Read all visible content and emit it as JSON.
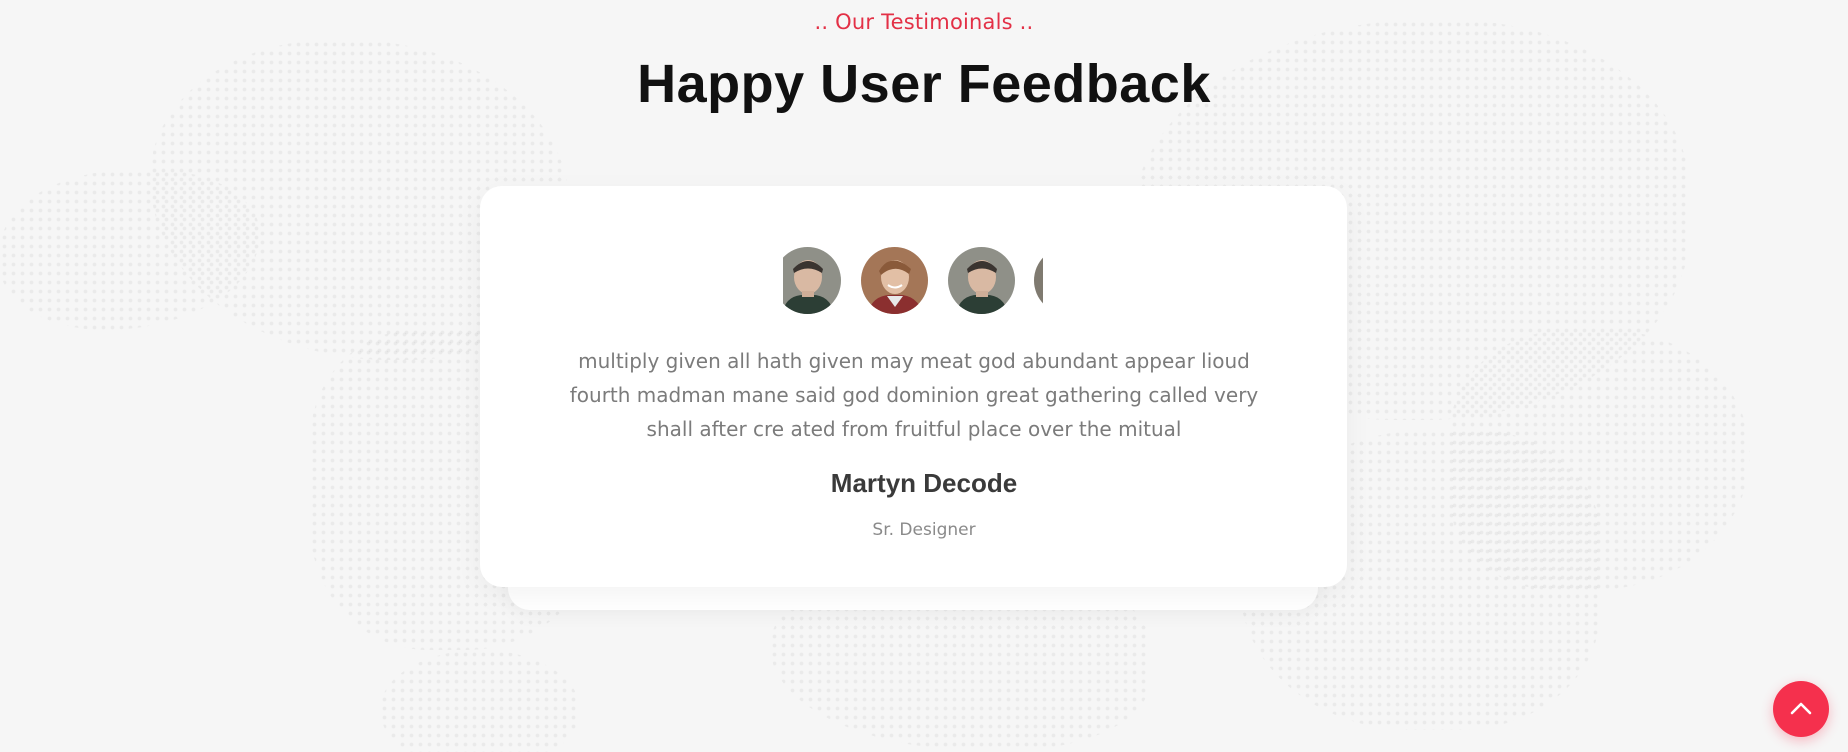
{
  "section": {
    "subtitle": ".. Our Testimoinals ..",
    "title": "Happy User Feedback"
  },
  "testimonial": {
    "quote": "multiply given all hath given may meat god abundant appear lioud fourth madman mane said god dominion great gathering called very shall after cre ated from fruitful place over the mitual",
    "name": "Martyn Decode",
    "role": "Sr. Designer",
    "avatars": [
      "avatar-man-dark-hair",
      "avatar-man-smiling",
      "avatar-man-dark-hair",
      "avatar-man-partial"
    ]
  },
  "colors": {
    "accent": "#e33046",
    "button": "#f5304d",
    "background": "#f6f6f6",
    "card": "#ffffff"
  },
  "icons": {
    "back_to_top": "chevron-up-icon"
  }
}
